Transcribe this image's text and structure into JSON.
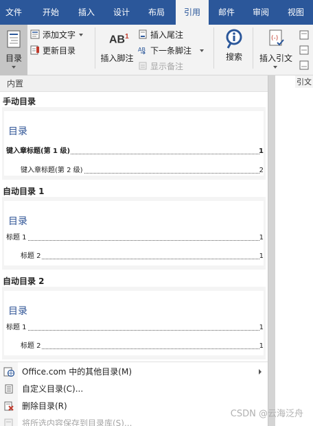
{
  "ribbon": {
    "tabs": [
      {
        "label": "文件",
        "active": false
      },
      {
        "label": "开始",
        "active": false
      },
      {
        "label": "插入",
        "active": false
      },
      {
        "label": "设计",
        "active": false
      },
      {
        "label": "布局",
        "active": false
      },
      {
        "label": "引用",
        "active": true
      },
      {
        "label": "邮件",
        "active": false
      },
      {
        "label": "审阅",
        "active": false
      },
      {
        "label": "视图",
        "active": false
      }
    ],
    "toc_button": "目录",
    "add_text": "添加文字",
    "update_toc": "更新目录",
    "insert_footnote": "插入脚注",
    "footnote_icon_text": "AB",
    "footnote_sup": "1",
    "insert_endnote": "插入尾注",
    "next_footnote": "下一条脚注",
    "show_notes": "显示备注",
    "search": "搜索",
    "insert_citation": "插入引文",
    "citation_group": "引文"
  },
  "dropdown": {
    "header": "内置",
    "galleries": [
      {
        "title": "手动目录",
        "preview_title": "目录",
        "lines": [
          {
            "text": "键入章标题(第 1 级)",
            "page": "1",
            "level": 1
          },
          {
            "text": "键入章标题(第 2 级)",
            "page": "2",
            "level": 2
          }
        ]
      },
      {
        "title": "自动目录 1",
        "preview_title": "目录",
        "lines": [
          {
            "text": "标题 1",
            "page": "1",
            "level": 1
          },
          {
            "text": "标题 2",
            "page": "1",
            "level": 2
          }
        ]
      },
      {
        "title": "自动目录 2",
        "preview_title": "目录",
        "lines": [
          {
            "text": "标题 1",
            "page": "1",
            "level": 1
          },
          {
            "text": "标题 2",
            "page": "1",
            "level": 2
          }
        ]
      }
    ],
    "commands": [
      {
        "label": "Office.com 中的其他目录(M)",
        "disabled": false
      },
      {
        "label": "自定义目录(C)...",
        "disabled": false
      },
      {
        "label": "删除目录(R)",
        "disabled": false
      },
      {
        "label": "将所选内容保存到目录库(S)...",
        "disabled": true
      }
    ]
  },
  "watermark": "CSDN @云海泛舟",
  "colors": {
    "ribbon_blue": "#2b579a",
    "toc_heading_blue": "#2f5496",
    "delete_red": "#c0392b"
  }
}
